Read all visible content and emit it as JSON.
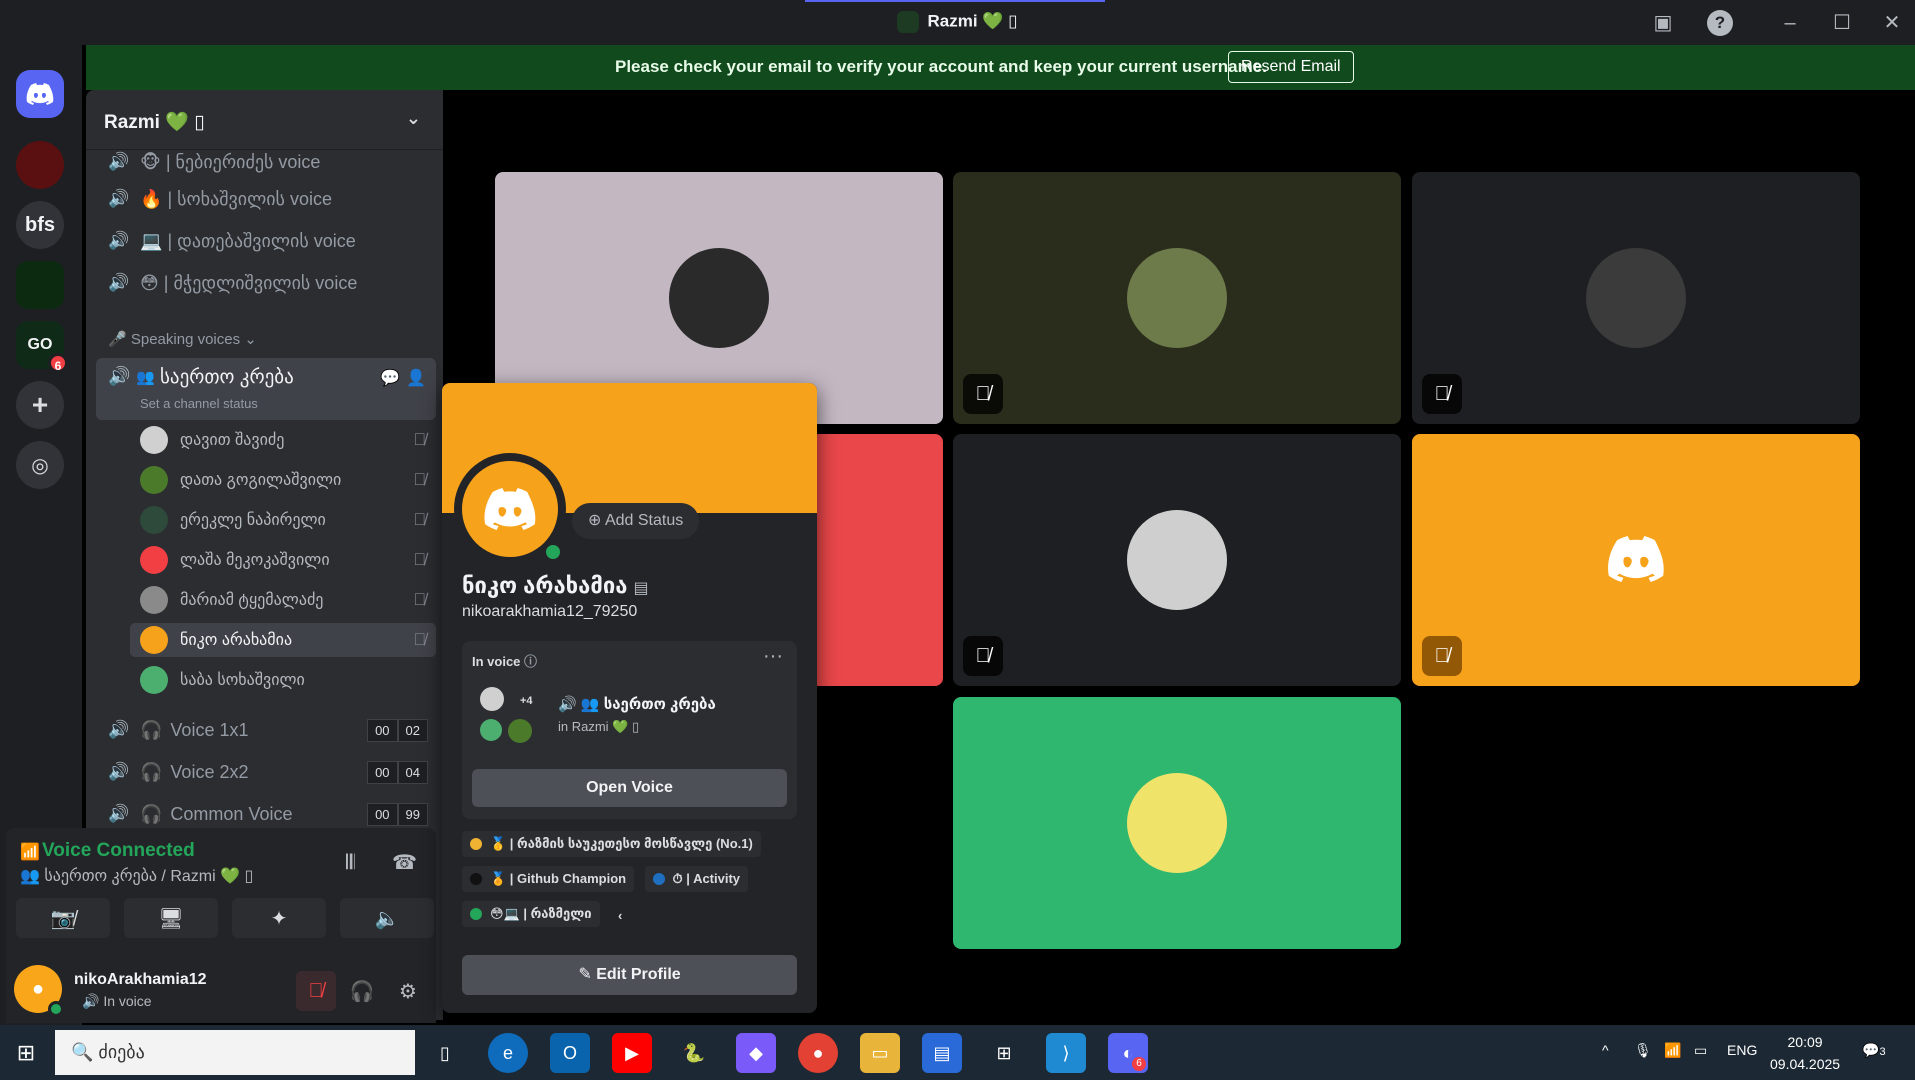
{
  "window": {
    "title": "Razmi 💚 ▯"
  },
  "banner": {
    "message": "Please check your email to verify your account and keep your current username.",
    "button": "Resend Email"
  },
  "guilds": [
    {
      "name": "discord-home",
      "label": ""
    },
    {
      "name": "server-red",
      "label": ""
    },
    {
      "name": "server-bfs",
      "label": "bfs"
    },
    {
      "name": "server-matrix",
      "label": ""
    },
    {
      "name": "server-go",
      "label": "GO",
      "badge": "6"
    },
    {
      "name": "add-server",
      "label": "+"
    },
    {
      "name": "explore",
      "label": ""
    }
  ],
  "server": {
    "name": "Razmi 💚 ▯"
  },
  "channels": {
    "top": [
      {
        "emoji": "🐵",
        "name": "| ნებიერიძეს voice"
      },
      {
        "emoji": "🔥",
        "name": "| სოხაშვილის voice"
      },
      {
        "emoji": "💻",
        "name": "| დათებაშვილის voice"
      },
      {
        "emoji": "😳",
        "name": "| მჭედლიშვილის voice"
      }
    ],
    "category": "Speaking voices",
    "active": {
      "name": "საერთო კრება",
      "status": "Set a channel status"
    },
    "members": [
      {
        "name": "დავით შავიძე",
        "color": "#d0d0d0"
      },
      {
        "name": "დათა გოგილაშვილი",
        "color": "#4a7a2a"
      },
      {
        "name": "ერეკლე ნაპირელი",
        "color": "#2e4a3a"
      },
      {
        "name": "ლაშა მეკოკაშვილი",
        "color": "#f23f43"
      },
      {
        "name": "მარიამ ტყემალაძე",
        "color": "#8a8a8a"
      },
      {
        "name": "ნიკო არახამია",
        "color": "#f7a21b"
      },
      {
        "name": "საბა სოხაშვილი",
        "color": "#4caf70"
      }
    ],
    "bottom": [
      {
        "name": "Voice 1x1",
        "c1": "00",
        "c2": "02"
      },
      {
        "name": "Voice 2x2",
        "c1": "00",
        "c2": "04"
      },
      {
        "name": "Common Voice",
        "c1": "00",
        "c2": "99"
      }
    ]
  },
  "voice": {
    "connected": "Voice Connected",
    "location": "საერთო კრება / Razmi 💚 ▯"
  },
  "user": {
    "name": "nikoArakhamia12",
    "status": "In voice"
  },
  "profile": {
    "display_name": "ნიკო არახამია",
    "username": "nikoarakhamia12_79250",
    "add_status": "Add Status",
    "in_voice_label": "In voice",
    "plus": "+4",
    "channel": "საერთო კრება",
    "server": "in Razmi 💚 ▯",
    "open_voice": "Open Voice",
    "roles": [
      {
        "color": "#f0b232",
        "label": "🥇 | რაზმის საუკეთესო მოსწავლე (No.1)"
      },
      {
        "color": "#111111",
        "label": "🏅 | Github Champion"
      },
      {
        "color": "#1f6fc1",
        "label": "⏱ | Activity"
      },
      {
        "color": "#23a55a",
        "label": "😳💻 | რაზმელი"
      }
    ],
    "edit": "Edit Profile"
  },
  "tiles": [
    {
      "bg": "#c3b7c2",
      "avatar": "#2a2a2a",
      "muted": false
    },
    {
      "bg": "#2a2d1c",
      "avatar": "#6d7a4a",
      "muted": true
    },
    {
      "bg": "#1e1f22",
      "avatar": "#3b3b3b",
      "muted": true
    },
    {
      "bg": "#e9474a",
      "avatar": "",
      "muted": false
    },
    {
      "bg": "#1e1f22",
      "avatar": "#cfcfcf",
      "muted": true
    },
    {
      "bg": "#f7a21b",
      "avatar": "",
      "muted": true
    },
    {
      "bg": "#2fb770",
      "avatar": "#f0e36a",
      "muted": false
    }
  ],
  "taskbar": {
    "search": "ძიება",
    "lang": "ENG",
    "time": "20:09",
    "date": "09.04.2025",
    "notif": "3",
    "discord_badge": "6"
  }
}
